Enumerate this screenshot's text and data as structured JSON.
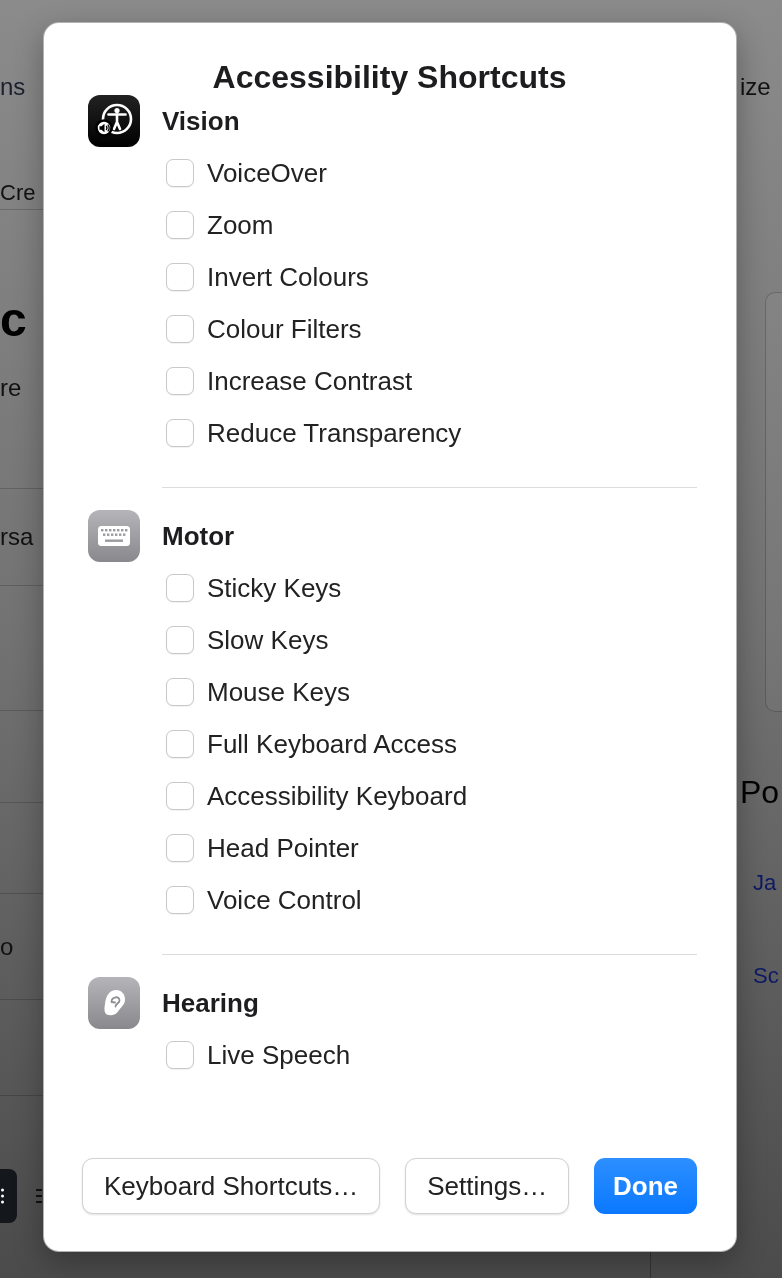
{
  "background": {
    "left": {
      "nav_item": "ns",
      "tab": "Cre",
      "heading": "c",
      "text": "re",
      "list_rows": [
        "rsa",
        "o"
      ]
    },
    "right": {
      "header_item": "ize",
      "heading": "Po",
      "links": [
        "Ja",
        "Sc"
      ]
    }
  },
  "dialog": {
    "title": "Accessibility Shortcuts",
    "sections": [
      {
        "kind": "vision",
        "title": "Vision",
        "options": [
          {
            "label": "VoiceOver",
            "checked": false
          },
          {
            "label": "Zoom",
            "checked": false
          },
          {
            "label": "Invert Colours",
            "checked": false
          },
          {
            "label": "Colour Filters",
            "checked": false
          },
          {
            "label": "Increase Contrast",
            "checked": false
          },
          {
            "label": "Reduce Transparency",
            "checked": false
          }
        ]
      },
      {
        "kind": "motor",
        "title": "Motor",
        "options": [
          {
            "label": "Sticky Keys",
            "checked": false
          },
          {
            "label": "Slow Keys",
            "checked": false
          },
          {
            "label": "Mouse Keys",
            "checked": false
          },
          {
            "label": "Full Keyboard Access",
            "checked": false
          },
          {
            "label": "Accessibility Keyboard",
            "checked": false
          },
          {
            "label": "Head Pointer",
            "checked": false
          },
          {
            "label": "Voice Control",
            "checked": false
          }
        ]
      },
      {
        "kind": "hearing",
        "title": "Hearing",
        "options": [
          {
            "label": "Live Speech",
            "checked": false
          }
        ]
      }
    ],
    "buttons": [
      {
        "kind": "secondary",
        "label": "Keyboard Shortcuts…"
      },
      {
        "kind": "secondary",
        "label": "Settings…"
      },
      {
        "kind": "primary",
        "label": "Done"
      }
    ]
  }
}
